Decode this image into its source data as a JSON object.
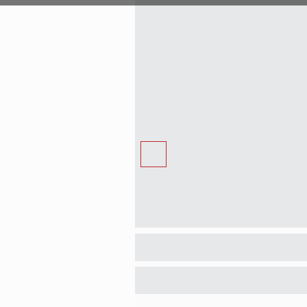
{
  "colors": {
    "top_bar_left": "#767676",
    "top_bar_right": "#6e6f6f",
    "sidebar_background": "#fcfcfc",
    "panel_background": "#e7e8e9",
    "selection_border": "#c0282a"
  },
  "regions": {
    "sidebar": {
      "label": ""
    },
    "main_panel": {
      "label": ""
    },
    "selection": {
      "label": ""
    },
    "rows": [
      {
        "label": ""
      },
      {
        "label": ""
      }
    ]
  }
}
